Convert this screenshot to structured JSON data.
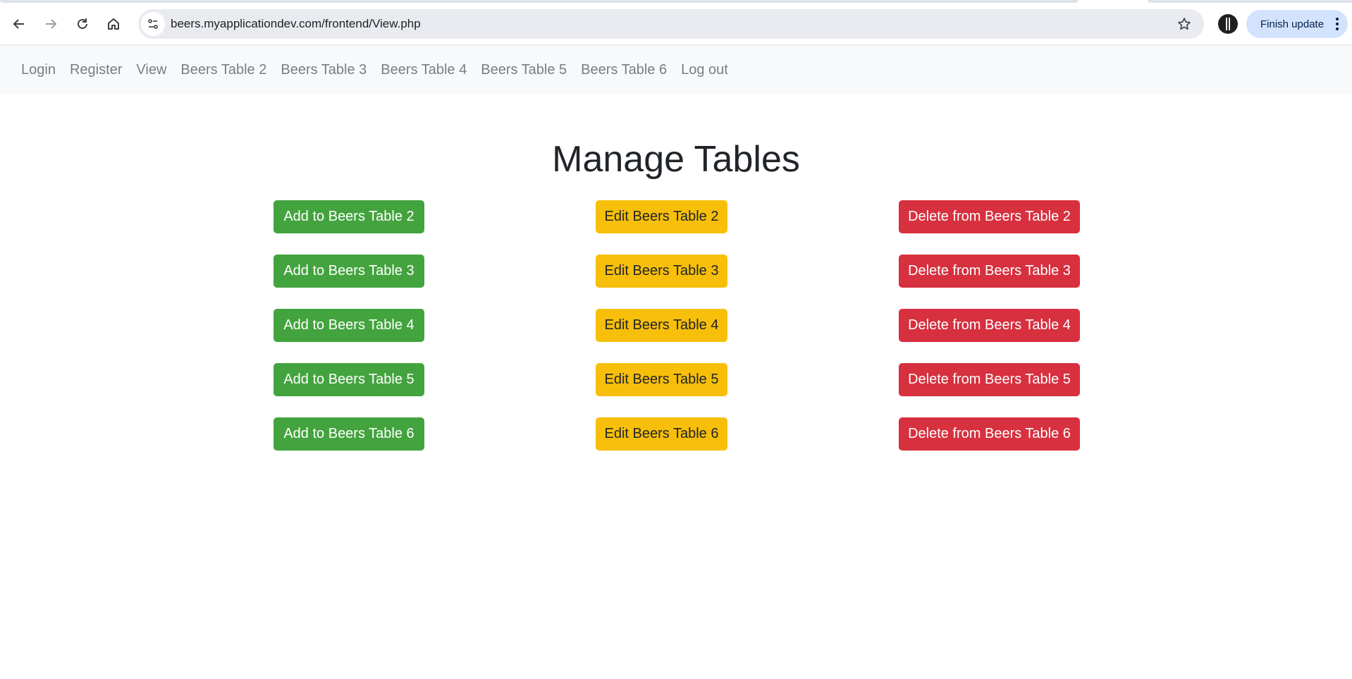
{
  "browser": {
    "url": "beers.myapplicationdev.com/frontend/View.php",
    "finish_update_label": "Finish update"
  },
  "nav": {
    "items": [
      {
        "label": "Login"
      },
      {
        "label": "Register"
      },
      {
        "label": "View"
      },
      {
        "label": "Beers Table 2"
      },
      {
        "label": "Beers Table 3"
      },
      {
        "label": "Beers Table 4"
      },
      {
        "label": "Beers Table 5"
      },
      {
        "label": "Beers Table 6"
      },
      {
        "label": "Log out"
      }
    ]
  },
  "main": {
    "title": "Manage Tables",
    "rows": [
      {
        "add": "Add to Beers Table 2",
        "edit": "Edit Beers Table 2",
        "delete": "Delete from Beers Table 2"
      },
      {
        "add": "Add to Beers Table 3",
        "edit": "Edit Beers Table 3",
        "delete": "Delete from Beers Table 3"
      },
      {
        "add": "Add to Beers Table 4",
        "edit": "Edit Beers Table 4",
        "delete": "Delete from Beers Table 4"
      },
      {
        "add": "Add to Beers Table 5",
        "edit": "Edit Beers Table 5",
        "delete": "Delete from Beers Table 5"
      },
      {
        "add": "Add to Beers Table 6",
        "edit": "Edit Beers Table 6",
        "delete": "Delete from Beers Table 6"
      }
    ]
  },
  "colors": {
    "add": "#43a33e",
    "edit": "#f7bf0a",
    "delete": "#d7303f"
  },
  "icons": {
    "back": "arrow-left-icon",
    "forward": "arrow-right-icon",
    "reload": "reload-icon",
    "home": "home-icon",
    "site_info": "tune-icon",
    "bookmark": "star-icon",
    "profile": "avatar-icon",
    "menu": "kebab-icon"
  }
}
